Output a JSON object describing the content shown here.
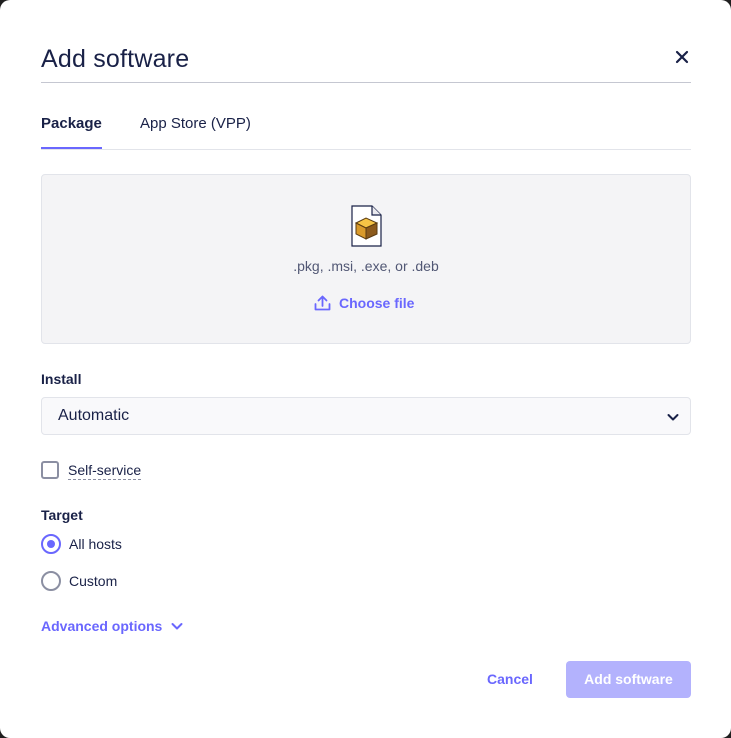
{
  "modal": {
    "title": "Add software",
    "close_icon": "close-icon"
  },
  "tabs": [
    {
      "label": "Package",
      "active": true
    },
    {
      "label": "App Store (VPP)",
      "active": false
    }
  ],
  "upload": {
    "icon": "package-file-icon",
    "hint": ".pkg, .msi, .exe, or .deb",
    "choose_label": "Choose file",
    "choose_icon": "upload-icon"
  },
  "install": {
    "label": "Install",
    "value": "Automatic",
    "chevron_icon": "chevron-down-icon"
  },
  "self_service": {
    "label": "Self-service",
    "checked": false
  },
  "target": {
    "label": "Target",
    "options": [
      {
        "label": "All hosts",
        "checked": true
      },
      {
        "label": "Custom",
        "checked": false
      }
    ]
  },
  "advanced": {
    "label": "Advanced options",
    "chevron_icon": "chevron-down-icon"
  },
  "footer": {
    "cancel_label": "Cancel",
    "submit_label": "Add software"
  },
  "colors": {
    "accent": "#6a67fe",
    "accent_disabled": "#b3b2fd",
    "text": "#192147",
    "muted_text": "#515774"
  }
}
